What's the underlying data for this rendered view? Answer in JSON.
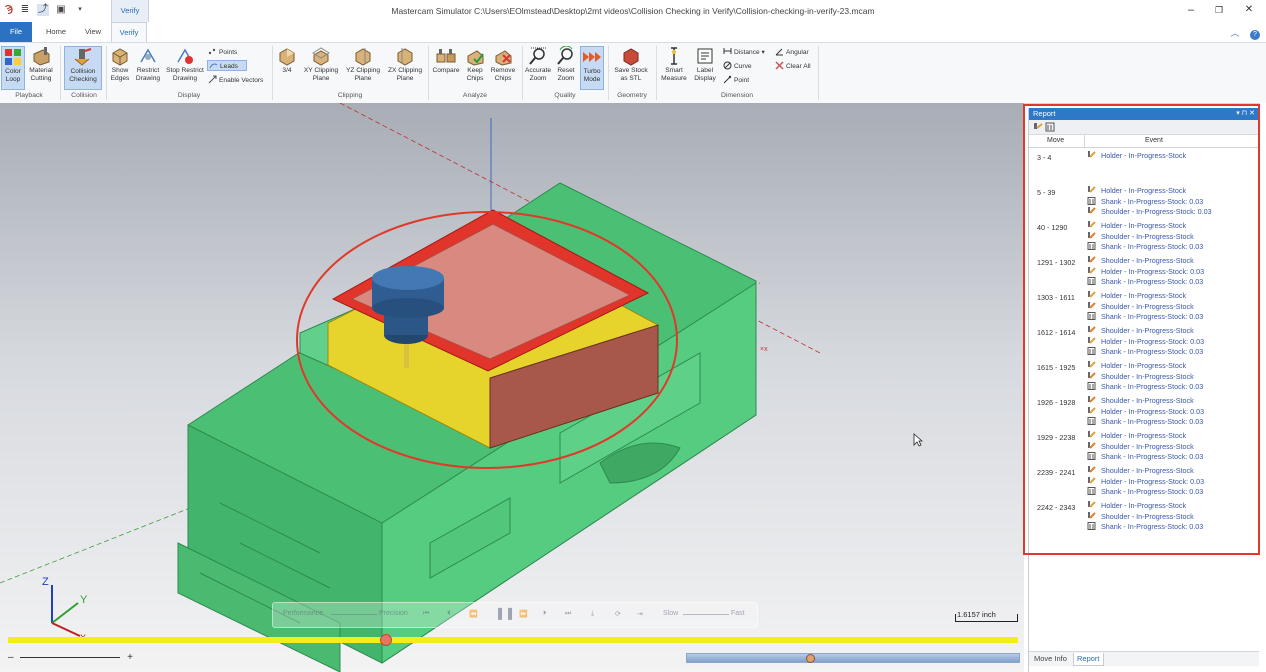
{
  "window": {
    "title": "Mastercam Simulator  C:\\Users\\EOlmstead\\Desktop\\2mt videos\\Collision Checking in Verify\\Collision-checking-in-verify-23.mcam",
    "context_tab": "Verify",
    "minimize": "–",
    "maximize": "❐",
    "close": "✕"
  },
  "tabs": {
    "file": "File",
    "home": "Home",
    "view": "View",
    "verify": "Verify"
  },
  "ribbon": {
    "color_loop": "Color Loop",
    "material_cutting": "Material Cutting",
    "collision_checking": "Collision Checking",
    "show_edges": "Show Edges",
    "restrict_drawing": "Restrict Drawing",
    "stop_restrict_drawing": "Stop Restrict Drawing",
    "points": "Points",
    "leads": "Leads",
    "enable_vectors": "Enable Vectors",
    "three_quarter": "3/4",
    "xy_clipping": "XY Clipping Plane",
    "yz_clipping": "YZ Clipping Plane",
    "zx_clipping": "ZX Clipping Plane",
    "compare": "Compare",
    "keep_chips": "Keep Chips",
    "remove_chips": "Remove Chips",
    "accurate_zoom": "Accurate Zoom",
    "reset_zoom": "Reset Zoom",
    "turbo_mode": "Turbo Mode",
    "save_stock_stl": "Save Stock as STL",
    "smart_measure": "Smart Measure",
    "label_display": "Label Display",
    "distance": "Distance",
    "angular": "Angular",
    "curve": "Curve",
    "clear_all": "Clear All",
    "point": "Point",
    "groups": {
      "playback": "Playback",
      "collision": "Collision",
      "display": "Display",
      "clipping": "Clipping",
      "analyze": "Analyze",
      "quality": "Quality",
      "geometry": "Geometry",
      "dimension": "Dimension"
    }
  },
  "viewport": {
    "scale_label": "1.6157 inch",
    "axis_labels": {
      "z": "Z",
      "y": "Y",
      "x": "X"
    },
    "playbar": {
      "performance": "Performance",
      "precision": "Precision",
      "slow": "Slow",
      "fast": "Fast"
    },
    "zoom_minus": "–",
    "zoom_plus": "+"
  },
  "report": {
    "title": "Report",
    "header_controls": "▾ ⊓ ✕",
    "col_move": "Move",
    "col_event": "Event",
    "rows": [
      {
        "move": "3 - 4",
        "events": [
          "Holder - In-Progress-Stock"
        ]
      },
      {
        "move": "5 - 39",
        "events": [
          "Holder - In-Progress-Stock",
          "Shank - In-Progress-Stock: 0.03",
          "Shoulder - In-Progress-Stock: 0.03"
        ]
      },
      {
        "move": "40 - 1290",
        "events": [
          "Holder - In-Progress-Stock",
          "Shoulder - In-Progress-Stock",
          "Shank - In-Progress-Stock: 0.03"
        ]
      },
      {
        "move": "1291 - 1302",
        "events": [
          "Shoulder - In-Progress-Stock",
          "Holder - In-Progress-Stock: 0.03",
          "Shank - In-Progress-Stock: 0.03"
        ]
      },
      {
        "move": "1303 - 1611",
        "events": [
          "Holder - In-Progress-Stock",
          "Shoulder - In-Progress-Stock",
          "Shank - In-Progress-Stock: 0.03"
        ]
      },
      {
        "move": "1612 - 1614",
        "events": [
          "Shoulder - In-Progress-Stock",
          "Holder - In-Progress-Stock: 0.03",
          "Shank - In-Progress-Stock: 0.03"
        ]
      },
      {
        "move": "1615 - 1925",
        "events": [
          "Holder - In-Progress-Stock",
          "Shoulder - In-Progress-Stock",
          "Shank - In-Progress-Stock: 0.03"
        ]
      },
      {
        "move": "1926 - 1928",
        "events": [
          "Shoulder - In-Progress-Stock",
          "Holder - In-Progress-Stock: 0.03",
          "Shank - In-Progress-Stock: 0.03"
        ]
      },
      {
        "move": "1929 - 2238",
        "events": [
          "Holder - In-Progress-Stock",
          "Shoulder - In-Progress-Stock",
          "Shank - In-Progress-Stock: 0.03"
        ]
      },
      {
        "move": "2239 - 2241",
        "events": [
          "Shoulder - In-Progress-Stock",
          "Holder - In-Progress-Stock: 0.03",
          "Shank - In-Progress-Stock: 0.03"
        ]
      },
      {
        "move": "2242 - 2343",
        "events": [
          "Holder - In-Progress-Stock",
          "Shoulder - In-Progress-Stock",
          "Shank - In-Progress-Stock: 0.03"
        ]
      }
    ],
    "tab_move_info": "Move Info",
    "tab_report": "Report"
  },
  "colors": {
    "file_tab": "#2b73c2",
    "report_header": "#2d78c7",
    "highlight_red": "#e0392a",
    "vise_green": "#4fc278",
    "stock_red": "#e23428",
    "stock_yellow": "#e7d62a",
    "tool_blue": "#2f5d92"
  }
}
